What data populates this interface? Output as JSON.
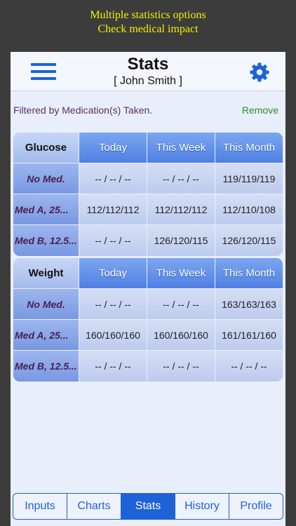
{
  "promo": {
    "line1": "Multiple statistics options",
    "line2": "Check medical impact"
  },
  "nav": {
    "title": "Stats",
    "user": "[ John  Smith ]"
  },
  "filter": {
    "text": "Filtered by Medication(s) Taken.",
    "remove_label": "Remove"
  },
  "glucose": {
    "headers": [
      "Glucose",
      "Today",
      "This Week",
      "This Month"
    ],
    "rows": [
      {
        "label": "No Med.",
        "values": [
          "-- / -- / --",
          "-- / -- / --",
          "119/119/119"
        ]
      },
      {
        "label": "Med A, 25...",
        "values": [
          "112/112/112",
          "112/112/112",
          "112/110/108"
        ]
      },
      {
        "label": "Med B, 12.5...",
        "values": [
          "-- / -- / --",
          "126/120/115",
          "126/120/115"
        ]
      }
    ]
  },
  "weight": {
    "headers": [
      "Weight",
      "Today",
      "This Week",
      "This Month"
    ],
    "rows": [
      {
        "label": "No Med.",
        "values": [
          "-- / -- / --",
          "-- / -- / --",
          "163/163/163"
        ]
      },
      {
        "label": "Med A, 25...",
        "values": [
          "160/160/160",
          "160/160/160",
          "161/161/160"
        ]
      },
      {
        "label": "Med B, 12.5...",
        "values": [
          "-- / -- / --",
          "-- / -- / --",
          "-- / -- / --"
        ]
      }
    ]
  },
  "tabs": [
    "Inputs",
    "Charts",
    "Stats",
    "History",
    "Profile"
  ],
  "colors": {
    "accent": "#1e62d8",
    "promo_text": "#f2f200",
    "remove": "#2c8a2c",
    "row_label": "#4a1f52"
  },
  "icons": {
    "menu": "hamburger-menu-icon",
    "settings": "gear-icon"
  }
}
